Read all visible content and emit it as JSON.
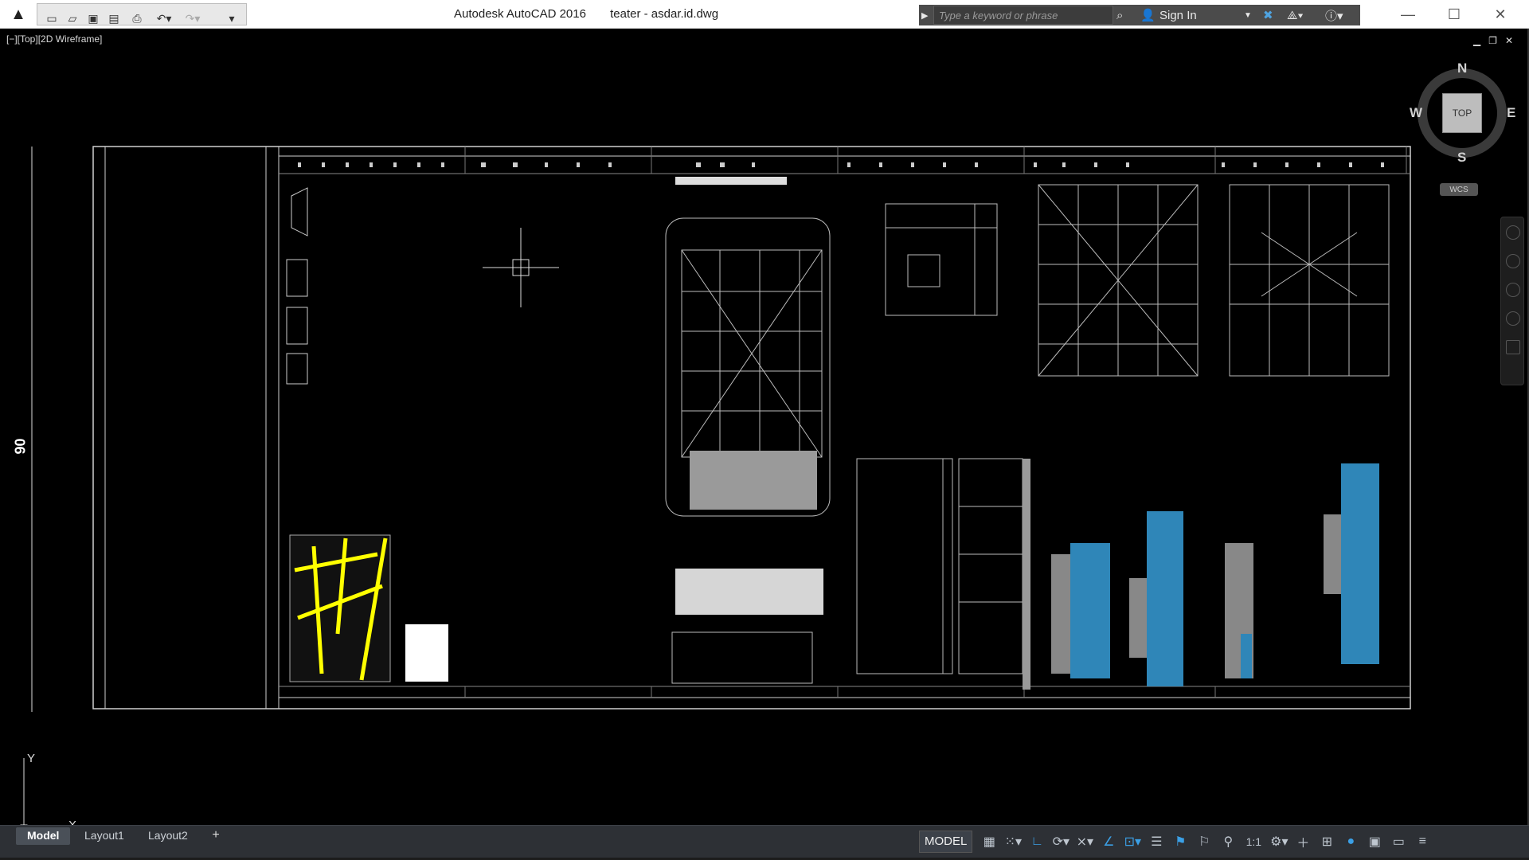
{
  "app": {
    "product": "Autodesk AutoCAD 2016",
    "document": "teater - asdar.id.dwg"
  },
  "infocenter": {
    "search_placeholder": "Type a keyword or phrase",
    "sign_in": "Sign In"
  },
  "viewport": {
    "label": "[−][Top][2D Wireframe]"
  },
  "viewcube": {
    "face": "TOP",
    "north": "N",
    "south": "S",
    "east": "E",
    "west": "W",
    "wcs": "WCS"
  },
  "drawing": {
    "scale_mark": "90",
    "ucs_x": "X",
    "ucs_y": "Y"
  },
  "layout_tabs": {
    "model": "Model",
    "layout1": "Layout1",
    "layout2": "Layout2",
    "add": "+"
  },
  "statusbar": {
    "model": "MODEL",
    "scale": "1:1"
  },
  "colors": {
    "accent": "#3ba0e6",
    "map_yellow": "#ffff00",
    "facade_blue": "#2f86b8"
  }
}
